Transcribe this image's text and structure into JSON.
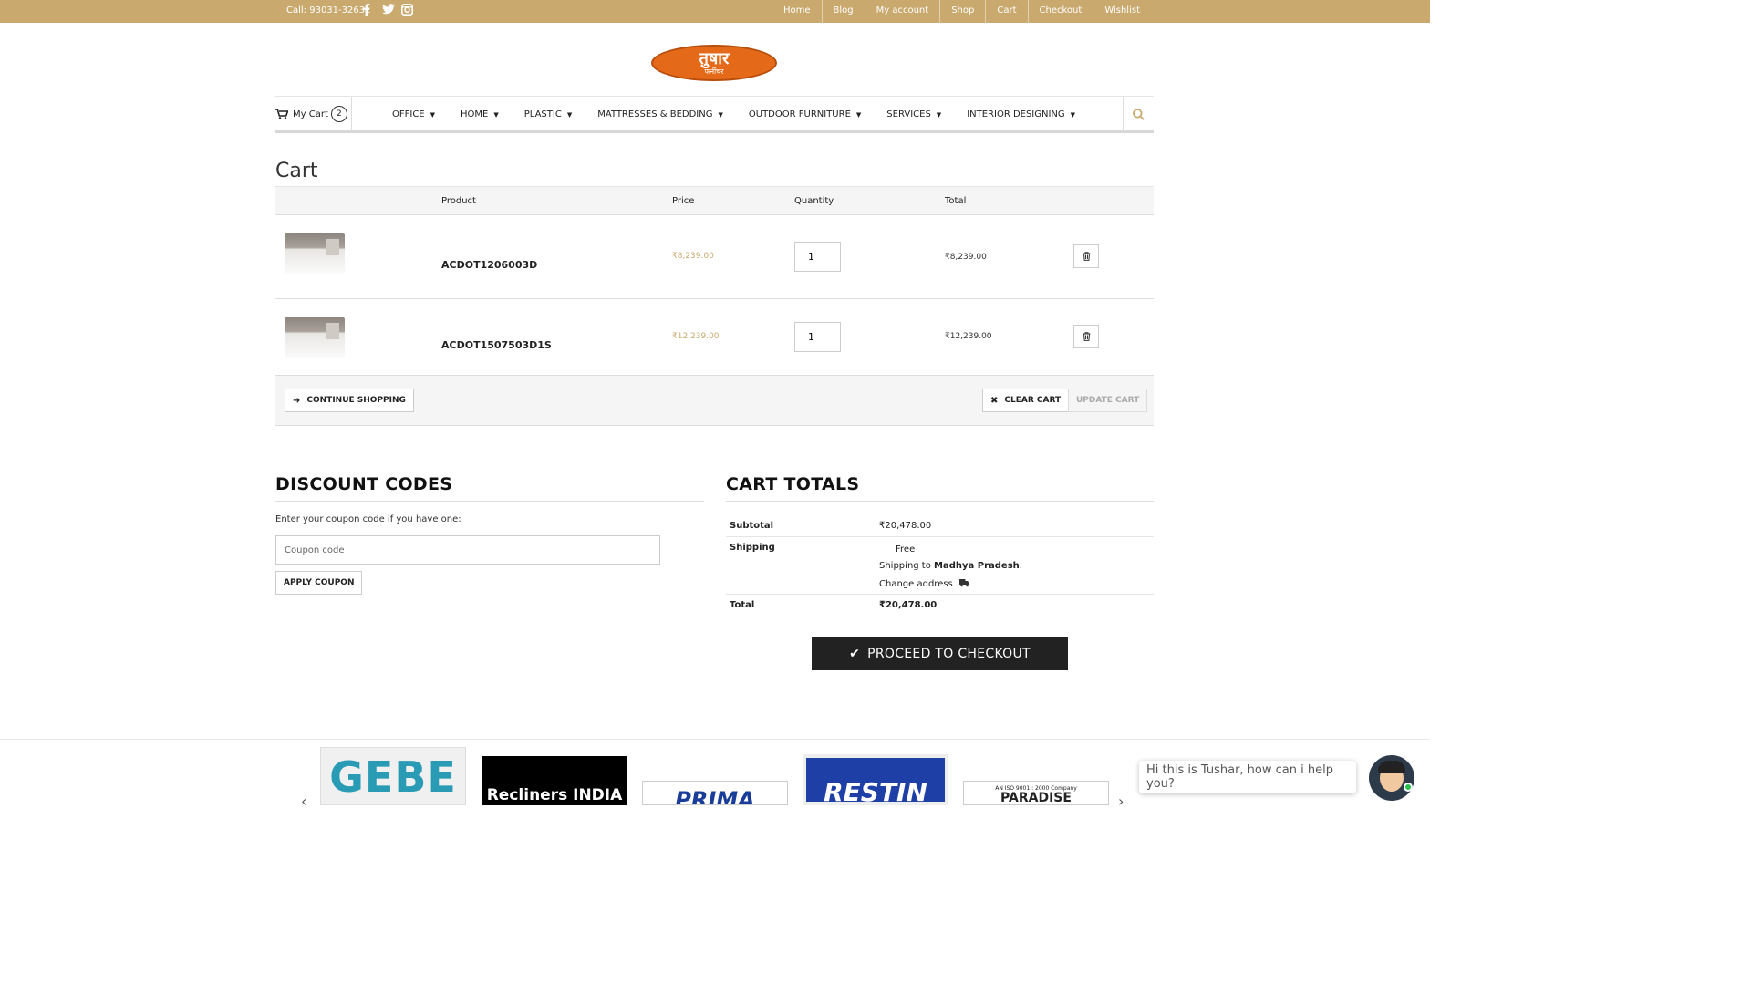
{
  "topbar": {
    "call": "Call: 93031-32631",
    "social_icons": [
      "facebook-icon",
      "twitter-icon",
      "instagram-icon"
    ],
    "links": [
      "Home",
      "Blog",
      "My account",
      "Shop",
      "Cart",
      "Checkout",
      "Wishlist"
    ]
  },
  "logo": {
    "line1": "तुषार",
    "line2": "फर्नीचर"
  },
  "nav": {
    "my_cart_label": "My Cart",
    "cart_count": "2",
    "menu": [
      "OFFICE",
      "HOME",
      "PLASTIC",
      "MATTRESSES & BEDDING",
      "OUTDOOR FURNITURE",
      "SERVICES",
      "INTERIOR DESIGNING"
    ],
    "caret": "▼"
  },
  "page_title": "Cart",
  "table": {
    "headers": {
      "product": "Product",
      "price": "Price",
      "quantity": "Quantity",
      "total": "Total"
    },
    "rows": [
      {
        "sku": "ACDOT1206003D",
        "price": "₹8,239.00",
        "qty": "1",
        "total": "₹8,239.00"
      },
      {
        "sku": "ACDOT1507503D1S",
        "price": "₹12,239.00",
        "qty": "1",
        "total": "₹12,239.00"
      }
    ]
  },
  "actions": {
    "continue": "CONTINUE SHOPPING",
    "clear": "CLEAR CART",
    "update": "UPDATE CART"
  },
  "discount": {
    "title": "DISCOUNT CODES",
    "label": "Enter your coupon code if you have one:",
    "placeholder": "Coupon code",
    "apply": "APPLY COUPON"
  },
  "totals": {
    "title": "CART TOTALS",
    "subtotal_label": "Subtotal",
    "subtotal": "₹20,478.00",
    "shipping_label": "Shipping",
    "shipping_method": "Free",
    "shipping_to_prefix": "Shipping to",
    "shipping_region": "Madhya Pradesh",
    "shipping_to_suffix": ".",
    "change_address": "Change address",
    "total_label": "Total",
    "total": "₹20,478.00",
    "checkout": "PROCEED TO CHECKOUT"
  },
  "brands": [
    {
      "name": "GEBE",
      "color": "#2a9bb5"
    },
    {
      "name": "Recliners INDIA",
      "color": "#ffffff"
    },
    {
      "name": "PRIMA",
      "color": "#1a3d9a"
    },
    {
      "name": "RESTIN",
      "color": "#ffffff"
    },
    {
      "name": "PARADISE",
      "color": "#222222"
    }
  ],
  "brand_note": "AN ISO 9001 : 2000 Company",
  "chat": {
    "message": "Hi this is Tushar, how can i help you?"
  },
  "colors": {
    "accent": "#c9a96e",
    "logo_orange": "#e46a1a",
    "dark": "#222222"
  }
}
